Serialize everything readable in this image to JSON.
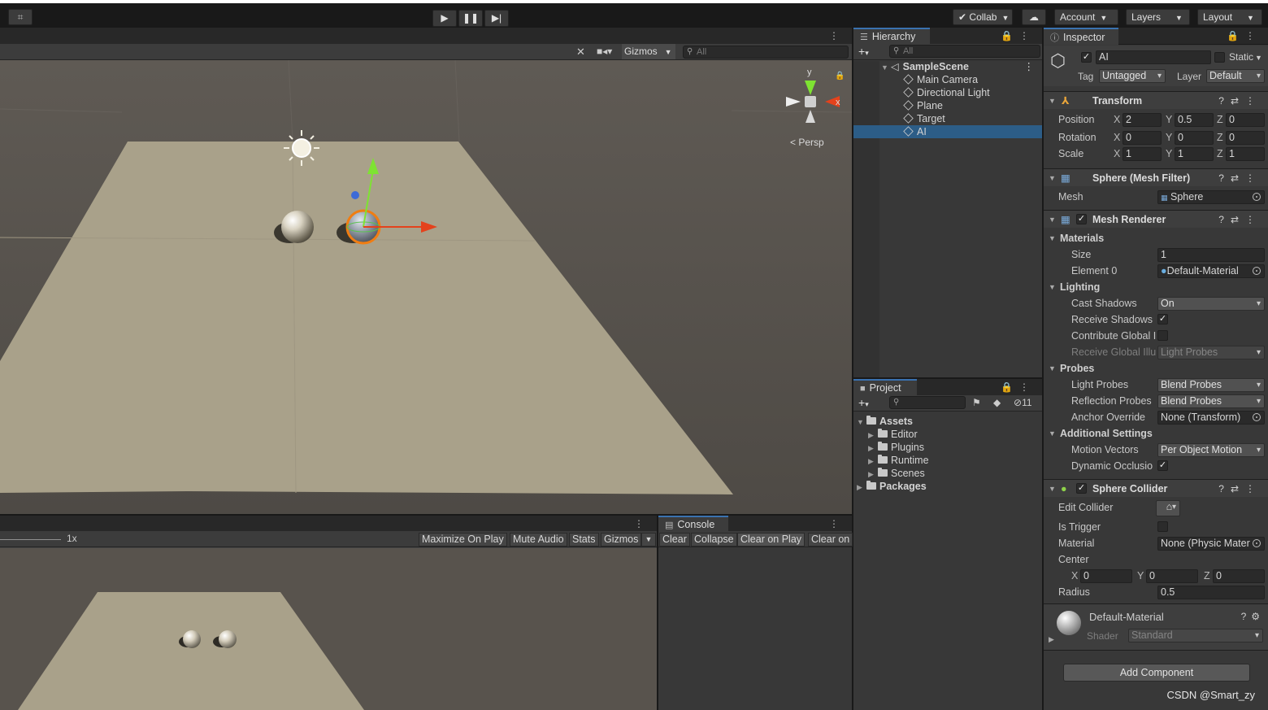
{
  "toolbar": {
    "collab": "Collab",
    "account": "Account",
    "layers": "Layers",
    "layout": "Layout"
  },
  "scene": {
    "gizmos": "Gizmos",
    "search_placeholder": "All",
    "persp": "Persp",
    "axis_y": "y",
    "axis_x": "x"
  },
  "game": {
    "scale": "1x",
    "maximize": "Maximize On Play",
    "mute": "Mute Audio",
    "stats": "Stats",
    "gizmos": "Gizmos"
  },
  "console": {
    "tab": "Console",
    "clear": "Clear",
    "collapse": "Collapse",
    "clear_on_play": "Clear on Play",
    "clear_on": "Clear on"
  },
  "hierarchy": {
    "tab": "Hierarchy",
    "search_placeholder": "All",
    "scene": "SampleScene",
    "items": [
      "Main Camera",
      "Directional Light",
      "Plane",
      "Target",
      "AI"
    ]
  },
  "project": {
    "tab": "Project",
    "hidden_count": "11",
    "assets": "Assets",
    "folders": [
      "Editor",
      "Plugins",
      "Runtime",
      "Scenes"
    ],
    "packages": "Packages"
  },
  "inspector": {
    "tab": "Inspector",
    "object_name": "AI",
    "static": "Static",
    "tag_label": "Tag",
    "tag": "Untagged",
    "layer_label": "Layer",
    "layer": "Default",
    "transform": {
      "title": "Transform",
      "position_label": "Position",
      "rotation_label": "Rotation",
      "scale_label": "Scale",
      "position": [
        "2",
        "0.5",
        "0"
      ],
      "rotation": [
        "0",
        "0",
        "0"
      ],
      "scale": [
        "1",
        "1",
        "1"
      ]
    },
    "mesh_filter": {
      "title": "Sphere (Mesh Filter)",
      "mesh_label": "Mesh",
      "mesh": "Sphere"
    },
    "mesh_renderer": {
      "title": "Mesh Renderer",
      "materials": "Materials",
      "size_label": "Size",
      "size": "1",
      "element0_label": "Element 0",
      "element0": "Default-Material",
      "lighting": "Lighting",
      "cast_shadows_label": "Cast Shadows",
      "cast_shadows": "On",
      "receive_shadows_label": "Receive Shadows",
      "contribute_gi_label": "Contribute Global I",
      "receive_gi_label": "Receive Global Illu",
      "receive_gi": "Light Probes",
      "probes": "Probes",
      "light_probes_label": "Light Probes",
      "light_probes": "Blend Probes",
      "reflection_probes_label": "Reflection Probes",
      "reflection_probes": "Blend Probes",
      "anchor_override_label": "Anchor Override",
      "anchor_override": "None (Transform)",
      "additional": "Additional Settings",
      "motion_vectors_label": "Motion Vectors",
      "motion_vectors": "Per Object Motion",
      "dynamic_occlusion_label": "Dynamic Occlusio"
    },
    "sphere_collider": {
      "title": "Sphere Collider",
      "edit_label": "Edit Collider",
      "is_trigger_label": "Is Trigger",
      "material_label": "Material",
      "material": "None (Physic Mater",
      "center_label": "Center",
      "center": [
        "0",
        "0",
        "0"
      ],
      "radius_label": "Radius",
      "radius": "0.5"
    },
    "material": {
      "name": "Default-Material",
      "shader_label": "Shader",
      "shader": "Standard"
    },
    "add_component": "Add Component",
    "watermark": "CSDN @Smart_zy"
  }
}
